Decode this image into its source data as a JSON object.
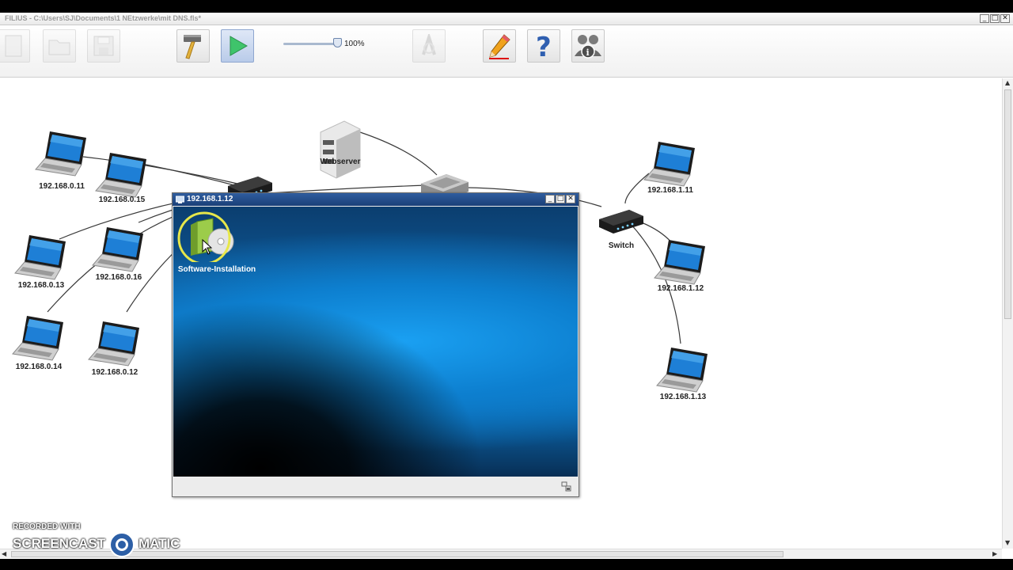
{
  "app": {
    "title": "FILIUS - C:\\Users\\SJ\\Documents\\1 NEtzwerke\\mit DNS.fls*",
    "controls": {
      "minimize": "_",
      "maximize": "□",
      "close": "✕"
    }
  },
  "toolbar": {
    "buttons": [
      {
        "name": "new-file-icon",
        "state": "disabled"
      },
      {
        "name": "open-file-icon",
        "state": "disabled"
      },
      {
        "name": "save-icon",
        "state": "disabled"
      },
      {
        "name": "design-mode-hammer-icon",
        "state": "normal"
      },
      {
        "name": "simulation-play-icon",
        "state": "active"
      },
      {
        "name": "documentation-icon",
        "state": "disabled"
      },
      {
        "name": "pencil-icon",
        "state": "normal"
      },
      {
        "name": "help-icon",
        "state": "normal"
      },
      {
        "name": "info-icon",
        "state": "normal"
      }
    ],
    "zoom": {
      "label": "100%",
      "value": 1.0
    }
  },
  "network": {
    "nodes": [
      {
        "id": "pc-0-11",
        "label": "192.168.0.11",
        "type": "laptop"
      },
      {
        "id": "pc-0-15",
        "label": "192.168.0.15",
        "type": "laptop"
      },
      {
        "id": "pc-0-13",
        "label": "192.168.0.13",
        "type": "laptop"
      },
      {
        "id": "pc-0-16",
        "label": "192.168.0.16",
        "type": "laptop"
      },
      {
        "id": "pc-0-14",
        "label": "192.168.0.14",
        "type": "laptop"
      },
      {
        "id": "pc-0-12",
        "label": "192.168.0.12",
        "type": "laptop"
      },
      {
        "id": "webserver",
        "label": "Webserver",
        "type": "server"
      },
      {
        "id": "pc-1-11",
        "label": "192.168.1.11",
        "type": "laptop"
      },
      {
        "id": "switch",
        "label": "Switch",
        "type": "switch"
      },
      {
        "id": "pc-1-12",
        "label": "192.168.1.12",
        "type": "laptop"
      },
      {
        "id": "pc-1-13",
        "label": "192.168.1.13",
        "type": "laptop"
      }
    ]
  },
  "desktop_window": {
    "title": "192.168.1.12",
    "controls": {
      "minimize": "_",
      "maximize": "□",
      "close": "✕"
    },
    "icons": [
      {
        "label": "Software-Installation",
        "icon": "software-installation-icon"
      }
    ]
  },
  "watermark": {
    "line1": "RECORDED WITH",
    "line2": "SCREENCAST",
    "line3": "MATIC"
  }
}
